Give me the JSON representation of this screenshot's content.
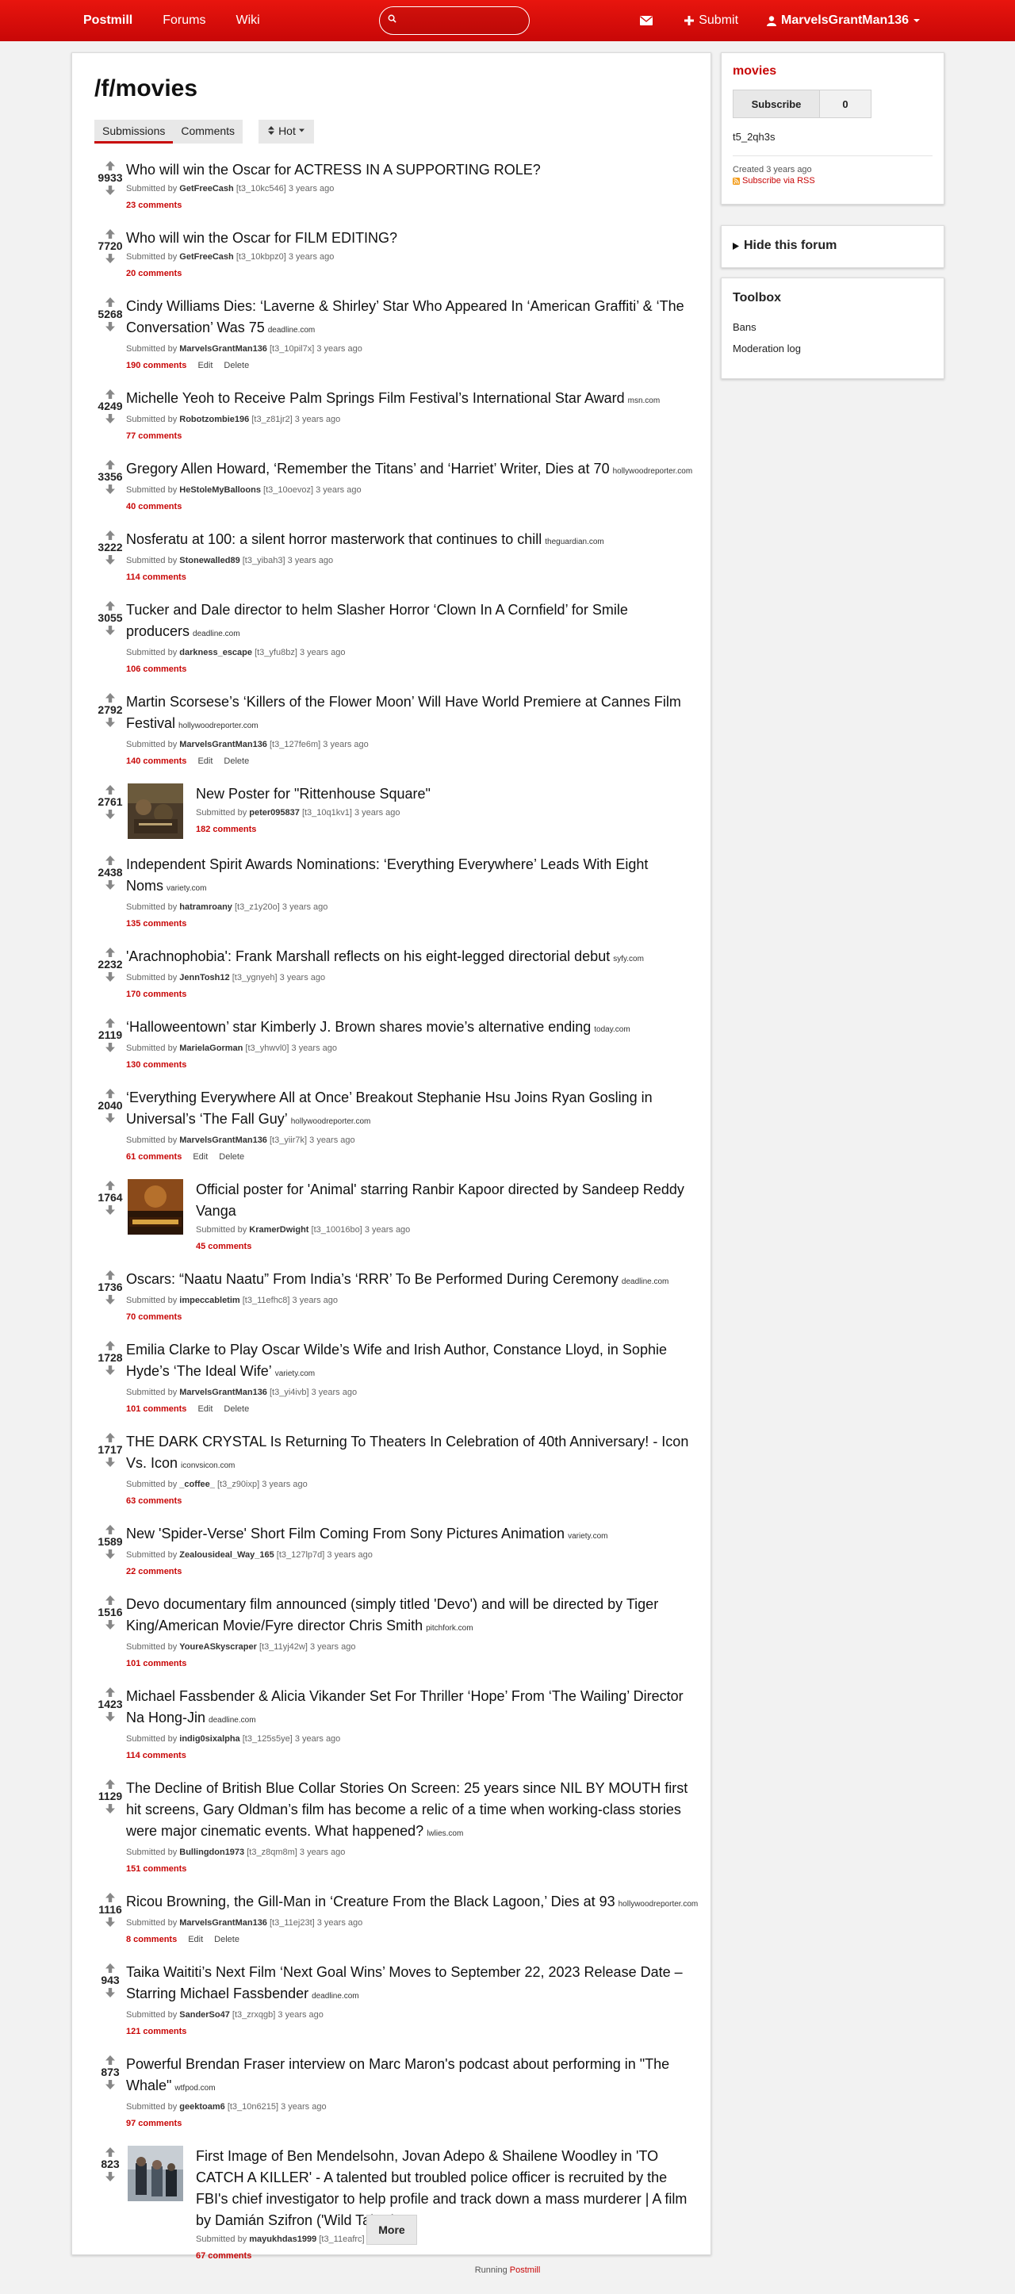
{
  "header": {
    "brand": "Postmill",
    "nav": [
      "Forums",
      "Wiki"
    ],
    "search_placeholder": "",
    "submit_label": "Submit",
    "username": "MarvelsGrantMan136"
  },
  "forum": {
    "title": "/f/movies",
    "tabs": [
      "Submissions",
      "Comments"
    ],
    "sort_label": "Hot"
  },
  "submissions": [
    {
      "score": "9933",
      "title": "Who will win the Oscar for ACTRESS IN A SUPPORTING ROLE?",
      "domain": "",
      "author": "GetFreeCash",
      "id": "[t3_10kc546]",
      "time": "3 years ago",
      "comments": "23 comments",
      "actions": [],
      "thumb": ""
    },
    {
      "score": "7720",
      "title": "Who will win the Oscar for FILM EDITING?",
      "domain": "",
      "author": "GetFreeCash",
      "id": "[t3_10kbpz0]",
      "time": "3 years ago",
      "comments": "20 comments",
      "actions": [],
      "thumb": ""
    },
    {
      "score": "5268",
      "title": "Cindy Williams Dies: ‘Laverne &amp; Shirley’ Star Who Appeared In ‘American Graffiti’ &amp; ‘The Conversation’ Was 75",
      "domain": "deadline.com",
      "author": "MarvelsGrantMan136",
      "id": "[t3_10pil7x]",
      "time": "3 years ago",
      "comments": "190 comments",
      "actions": [
        "Edit",
        "Delete"
      ],
      "thumb": ""
    },
    {
      "score": "4249",
      "title": "Michelle Yeoh to Receive Palm Springs Film Festival’s International Star Award",
      "domain": "msn.com",
      "author": "Robotzombie196",
      "id": "[t3_z81jr2]",
      "time": "3 years ago",
      "comments": "77 comments",
      "actions": [],
      "thumb": ""
    },
    {
      "score": "3356",
      "title": "Gregory Allen Howard, ‘Remember the Titans’ and ‘Harriet’ Writer, Dies at 70",
      "domain": "hollywoodreporter.com",
      "author": "HeStoleMyBalloons",
      "id": "[t3_10oevoz]",
      "time": "3 years ago",
      "comments": "40 comments",
      "actions": [],
      "thumb": ""
    },
    {
      "score": "3222",
      "title": "Nosferatu at 100: a silent horror masterwork that continues to chill",
      "domain": "theguardian.com",
      "author": "Stonewalled89",
      "id": "[t3_yibah3]",
      "time": "3 years ago",
      "comments": "114 comments",
      "actions": [],
      "thumb": ""
    },
    {
      "score": "3055",
      "title": "Tucker and Dale director to helm Slasher Horror ‘Clown In A Cornfield’ for Smile producers",
      "domain": "deadline.com",
      "author": "darkness_escape",
      "id": "[t3_yfu8bz]",
      "time": "3 years ago",
      "comments": "106 comments",
      "actions": [],
      "thumb": ""
    },
    {
      "score": "2792",
      "title": "Martin Scorsese’s ‘Killers of the Flower Moon’ Will Have World Premiere at Cannes Film Festival",
      "domain": "hollywoodreporter.com",
      "author": "MarvelsGrantMan136",
      "id": "[t3_127fe6m]",
      "time": "3 years ago",
      "comments": "140 comments",
      "actions": [
        "Edit",
        "Delete"
      ],
      "thumb": ""
    },
    {
      "score": "2761",
      "title": "New Poster for \"Rittenhouse Square\"",
      "domain": "",
      "author": "peter095837",
      "id": "[t3_10q1kv1]",
      "time": "3 years ago",
      "comments": "182 comments",
      "actions": [],
      "thumb": "rittenhouse"
    },
    {
      "score": "2438",
      "title": "Independent Spirit Awards Nominations: ‘Everything Everywhere’ Leads With Eight Noms",
      "domain": "variety.com",
      "author": "hatramroany",
      "id": "[t3_z1y20o]",
      "time": "3 years ago",
      "comments": "135 comments",
      "actions": [],
      "thumb": ""
    },
    {
      "score": "2232",
      "title": "'Arachnophobia': Frank Marshall reflects on his eight-legged directorial debut",
      "domain": "syfy.com",
      "author": "JennTosh12",
      "id": "[t3_ygnyeh]",
      "time": "3 years ago",
      "comments": "170 comments",
      "actions": [],
      "thumb": ""
    },
    {
      "score": "2119",
      "title": "‘Halloweentown’ star Kimberly J. Brown shares movie’s alternative ending",
      "domain": "today.com",
      "author": "MarielaGorman",
      "id": "[t3_yhwvl0]",
      "time": "3 years ago",
      "comments": "130 comments",
      "actions": [],
      "thumb": ""
    },
    {
      "score": "2040",
      "title": "‘Everything Everywhere All at Once’ Breakout Stephanie Hsu Joins Ryan Gosling in Universal’s ‘The Fall Guy’",
      "domain": "hollywoodreporter.com",
      "author": "MarvelsGrantMan136",
      "id": "[t3_yiir7k]",
      "time": "3 years ago",
      "comments": "61 comments",
      "actions": [
        "Edit",
        "Delete"
      ],
      "thumb": ""
    },
    {
      "score": "1764",
      "title": "Official poster for 'Animal' starring Ranbir Kapoor directed by Sandeep Reddy Vanga",
      "domain": "",
      "author": "KramerDwight",
      "id": "[t3_10016bo]",
      "time": "3 years ago",
      "comments": "45 comments",
      "actions": [],
      "thumb": "animal"
    },
    {
      "score": "1736",
      "title": "Oscars: “Naatu Naatu” From India’s ‘RRR’ To Be Performed During Ceremony",
      "domain": "deadline.com",
      "author": "impeccabletim",
      "id": "[t3_11efhc8]",
      "time": "3 years ago",
      "comments": "70 comments",
      "actions": [],
      "thumb": ""
    },
    {
      "score": "1728",
      "title": "Emilia Clarke to Play Oscar Wilde’s Wife and Irish Author, Constance Lloyd, in Sophie Hyde’s ‘The Ideal Wife’",
      "domain": "variety.com",
      "author": "MarvelsGrantMan136",
      "id": "[t3_yi4ivb]",
      "time": "3 years ago",
      "comments": "101 comments",
      "actions": [
        "Edit",
        "Delete"
      ],
      "thumb": ""
    },
    {
      "score": "1717",
      "title": "THE DARK CRYSTAL Is Returning To Theaters In Celebration of 40th Anniversary! - Icon Vs. Icon",
      "domain": "iconvsicon.com",
      "author": "_coffee_",
      "id": "[t3_z90ixp]",
      "time": "3 years ago",
      "comments": "63 comments",
      "actions": [],
      "thumb": ""
    },
    {
      "score": "1589",
      "title": "New 'Spider-Verse' Short Film Coming From Sony Pictures Animation",
      "domain": "variety.com",
      "author": "Zealousideal_Way_165",
      "id": "[t3_127lp7d]",
      "time": "3 years ago",
      "comments": "22 comments",
      "actions": [],
      "thumb": ""
    },
    {
      "score": "1516",
      "title": "Devo documentary film announced (simply titled 'Devo') and will be directed by Tiger King/American Movie/Fyre director Chris Smith",
      "domain": "pitchfork.com",
      "author": "YoureASkyscraper",
      "id": "[t3_11yj42w]",
      "time": "3 years ago",
      "comments": "101 comments",
      "actions": [],
      "thumb": ""
    },
    {
      "score": "1423",
      "title": "Michael Fassbender &amp; Alicia Vikander Set For Thriller ‘Hope’ From ‘The Wailing’ Director Na Hong-Jin",
      "domain": "deadline.com",
      "author": "indig0sixalpha",
      "id": "[t3_125s5ye]",
      "time": "3 years ago",
      "comments": "114 comments",
      "actions": [],
      "thumb": ""
    },
    {
      "score": "1129",
      "title": "The Decline of British Blue Collar Stories On Screen: 25 years since NIL BY MOUTH first hit screens, Gary Oldman’s film has become a relic of a time when working-class stories were major cinematic events. What happened?",
      "domain": "lwlies.com",
      "author": "Bullingdon1973",
      "id": "[t3_z8qm8m]",
      "time": "3 years ago",
      "comments": "151 comments",
      "actions": [],
      "thumb": ""
    },
    {
      "score": "1116",
      "title": "Ricou Browning, the Gill-Man in ‘Creature From the Black Lagoon,’ Dies at 93",
      "domain": "hollywoodreporter.com",
      "author": "MarvelsGrantMan136",
      "id": "[t3_11ej23t]",
      "time": "3 years ago",
      "comments": "8 comments",
      "actions": [
        "Edit",
        "Delete"
      ],
      "thumb": ""
    },
    {
      "score": "943",
      "title": "Taika Waititi’s Next Film ‘Next Goal Wins’ Moves to September 22, 2023 Release Date – Starring Michael Fassbender",
      "domain": "deadline.com",
      "author": "SanderSo47",
      "id": "[t3_zrxqgb]",
      "time": "3 years ago",
      "comments": "121 comments",
      "actions": [],
      "thumb": ""
    },
    {
      "score": "873",
      "title": "Powerful Brendan Fraser interview on Marc Maron's podcast about performing in \"The Whale\"",
      "domain": "wtfpod.com",
      "author": "geektoam6",
      "id": "[t3_10n6215]",
      "time": "3 years ago",
      "comments": "97 comments",
      "actions": [],
      "thumb": ""
    },
    {
      "score": "823",
      "title": "First Image of Ben Mendelsohn, Jovan Adepo &amp; Shailene Woodley in 'TO CATCH A KILLER' - A talented but troubled police officer is recruited by the FBI's chief investigator to help profile and track down a mass murderer | A film by Damián Szifron ('Wild Tales')",
      "domain": "",
      "author": "mayukhdas1999",
      "id": "[t3_11eafrc]",
      "time": "3 years ago",
      "comments": "67 comments",
      "actions": [],
      "thumb": "killer"
    }
  ],
  "more_label": "More",
  "sidebar": {
    "forum_name": "movies",
    "subscribe_label": "Subscribe",
    "subscriber_count": "0",
    "forum_id": "t5_2qh3s",
    "created": "Created 3 years ago",
    "rss_label": "Subscribe via RSS",
    "hide_label": "Hide this forum",
    "toolbox_title": "Toolbox",
    "toolbox_links": [
      "Bans",
      "Moderation log"
    ]
  },
  "footer": {
    "prefix": "Running",
    "link": "Postmill"
  },
  "labels": {
    "submitted_by": "Submitted by"
  },
  "colors": {
    "brand": "#c80707",
    "topbar": "#e8150e",
    "accent_text": "#c80707"
  }
}
